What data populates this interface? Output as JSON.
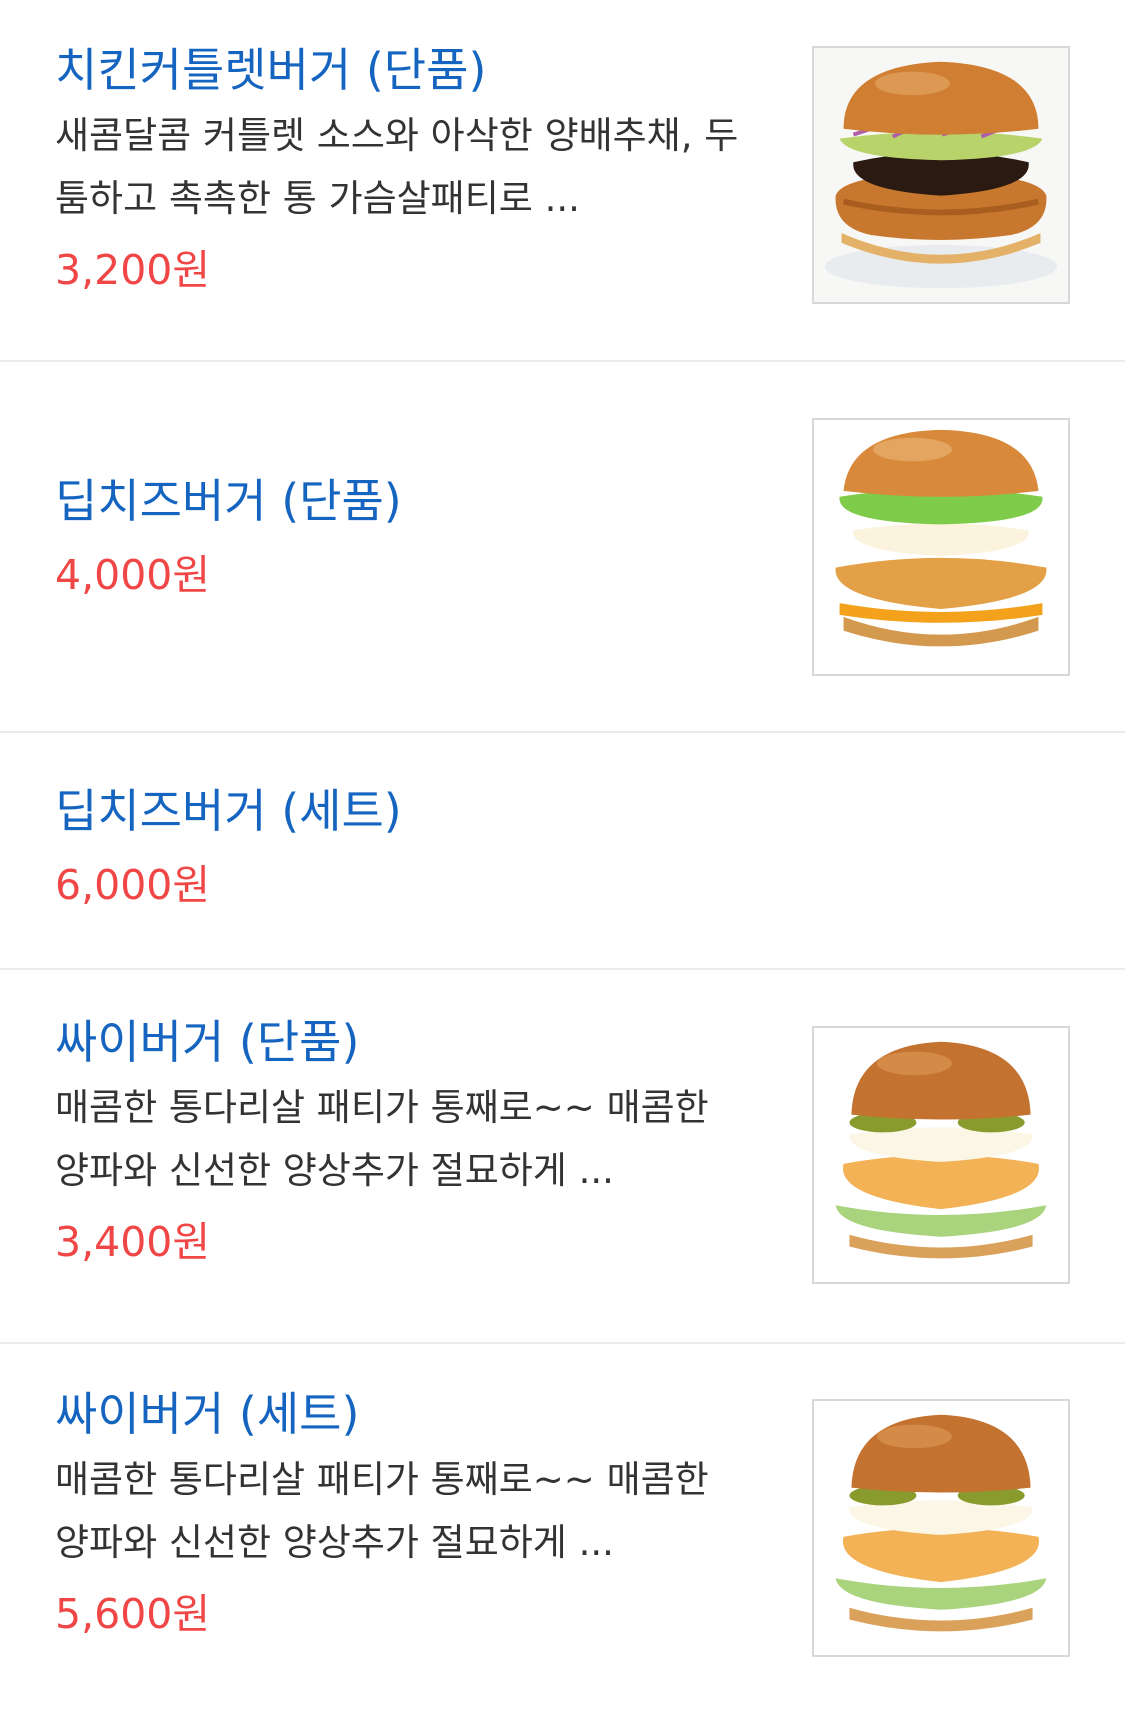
{
  "menu": {
    "items": [
      {
        "name": "치킨커틀렛버거 (단품)",
        "description": "새콤달콤 커틀렛 소스와 아삭한 양배추채, 두툼하고 촉촉한 통 가슴살패티로 ...",
        "price": "3,200원",
        "image": "chicken-cutlet-burger"
      },
      {
        "name": "딥치즈버거 (단품)",
        "description": "",
        "price": "4,000원",
        "image": "deep-cheese-burger"
      },
      {
        "name": "딥치즈버거 (세트)",
        "description": "",
        "price": "6,000원",
        "image": ""
      },
      {
        "name": "싸이버거 (단품)",
        "description": "매콤한 통다리살 패티가 통째로~~ 매콤한 양파와 신선한 양상추가 절묘하게 ...",
        "price": "3,400원",
        "image": "thigh-burger"
      },
      {
        "name": "싸이버거 (세트)",
        "description": "매콤한 통다리살 패티가 통째로~~ 매콤한 양파와 신선한 양상추가 절묘하게 ...",
        "price": "5,600원",
        "image": "thigh-burger"
      }
    ]
  },
  "colors": {
    "name": "#1565c0",
    "price": "#f04646",
    "description": "#333333",
    "divider": "#ececec"
  }
}
